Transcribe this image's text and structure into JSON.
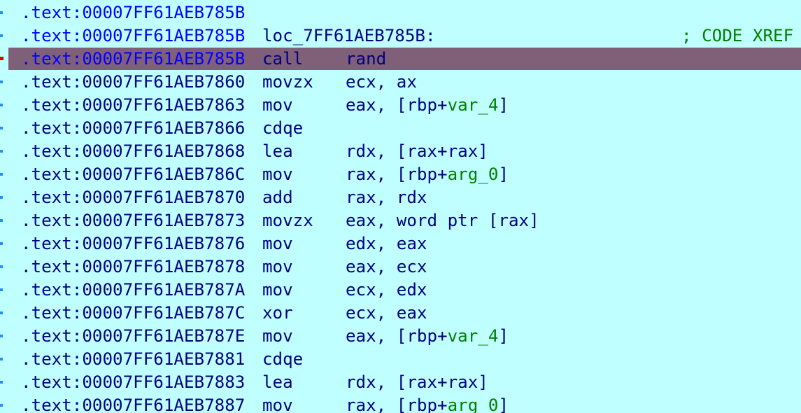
{
  "colors": {
    "background": "#c0ffff",
    "selected_row": "#806078",
    "address_text": "#000080",
    "label_address": "#0000ff",
    "stack_var": "#008000",
    "comment": "#008000"
  },
  "listing": {
    "lines": [
      {
        "addr": ".text:00007FF61AEB785B",
        "label": "",
        "mn": "",
        "op1": "",
        "var": "",
        "op2": "",
        "xref": ""
      },
      {
        "addr": ".text:00007FF61AEB785B",
        "label": "loc_7FF61AEB785B:",
        "mn": "",
        "op1": "",
        "var": "",
        "op2": "",
        "xref": "; CODE XREF"
      },
      {
        "addr": ".text:00007FF61AEB785B",
        "label": "",
        "mn": "call",
        "op1": "rand",
        "var": "",
        "op2": "",
        "xref": ""
      },
      {
        "addr": ".text:00007FF61AEB7860",
        "label": "",
        "mn": "movzx",
        "op1": "ecx, ax",
        "var": "",
        "op2": "",
        "xref": ""
      },
      {
        "addr": ".text:00007FF61AEB7863",
        "label": "",
        "mn": "mov",
        "op1": "eax, [rbp+",
        "var": "var_4",
        "op2": "]",
        "xref": ""
      },
      {
        "addr": ".text:00007FF61AEB7866",
        "label": "",
        "mn": "cdqe",
        "op1": "",
        "var": "",
        "op2": "",
        "xref": ""
      },
      {
        "addr": ".text:00007FF61AEB7868",
        "label": "",
        "mn": "lea",
        "op1": "rdx, [rax+rax]",
        "var": "",
        "op2": "",
        "xref": ""
      },
      {
        "addr": ".text:00007FF61AEB786C",
        "label": "",
        "mn": "mov",
        "op1": "rax, [rbp+",
        "var": "arg_0",
        "op2": "]",
        "xref": ""
      },
      {
        "addr": ".text:00007FF61AEB7870",
        "label": "",
        "mn": "add",
        "op1": "rax, rdx",
        "var": "",
        "op2": "",
        "xref": ""
      },
      {
        "addr": ".text:00007FF61AEB7873",
        "label": "",
        "mn": "movzx",
        "op1": "eax, word ptr [rax]",
        "var": "",
        "op2": "",
        "xref": ""
      },
      {
        "addr": ".text:00007FF61AEB7876",
        "label": "",
        "mn": "mov",
        "op1": "edx, eax",
        "var": "",
        "op2": "",
        "xref": ""
      },
      {
        "addr": ".text:00007FF61AEB7878",
        "label": "",
        "mn": "mov",
        "op1": "eax, ecx",
        "var": "",
        "op2": "",
        "xref": ""
      },
      {
        "addr": ".text:00007FF61AEB787A",
        "label": "",
        "mn": "mov",
        "op1": "ecx, edx",
        "var": "",
        "op2": "",
        "xref": ""
      },
      {
        "addr": ".text:00007FF61AEB787C",
        "label": "",
        "mn": "xor",
        "op1": "ecx, eax",
        "var": "",
        "op2": "",
        "xref": ""
      },
      {
        "addr": ".text:00007FF61AEB787E",
        "label": "",
        "mn": "mov",
        "op1": "eax, [rbp+",
        "var": "var_4",
        "op2": "]",
        "xref": ""
      },
      {
        "addr": ".text:00007FF61AEB7881",
        "label": "",
        "mn": "cdqe",
        "op1": "",
        "var": "",
        "op2": "",
        "xref": ""
      },
      {
        "addr": ".text:00007FF61AEB7883",
        "label": "",
        "mn": "lea",
        "op1": "rdx, [rax+rax]",
        "var": "",
        "op2": "",
        "xref": ""
      },
      {
        "addr": ".text:00007FF61AEB7887",
        "label": "",
        "mn": "mov",
        "op1": "rax, [rbp+",
        "var": "arg_0",
        "op2": "]",
        "xref": ""
      }
    ]
  }
}
